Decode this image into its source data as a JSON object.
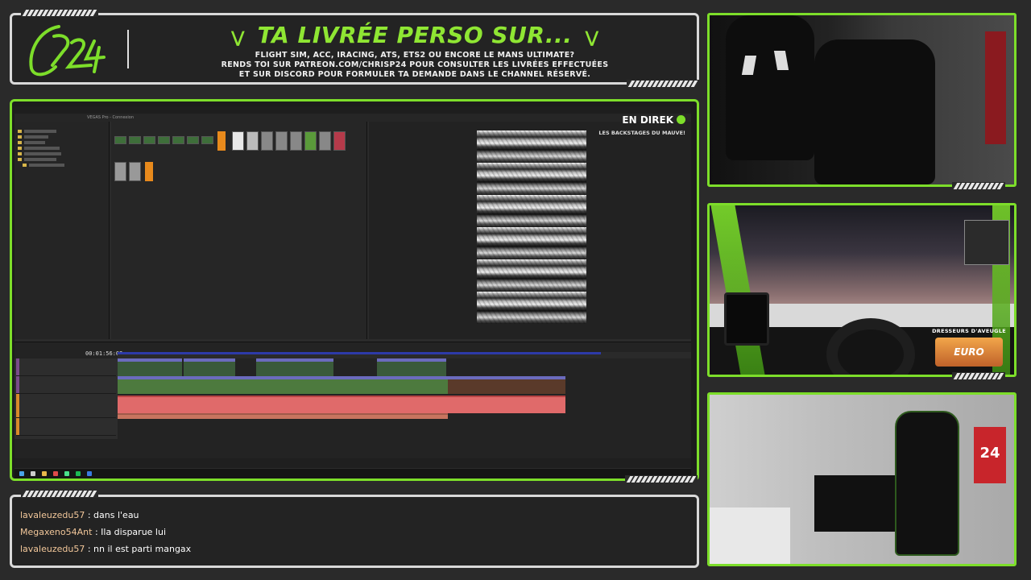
{
  "banner": {
    "title": "TA LIVRÉE PERSO SUR...",
    "line1": "FLIGHT SIM, ACC, IRACING, ATS, ETS2 OU ENCORE LE MANS ULTIMATE?",
    "line2": "RENDS TOI SUR PATREON.COM/CHRISP24 POUR CONSULTER LES LIVRÉES EFFECTUÉES",
    "line3": "ET SUR DISCORD POUR FORMULER TA DEMANDE DANS LE CHANNEL RÉSERVÉ.",
    "logo_icon": "cp24-logo"
  },
  "live": {
    "title": "EN DIREK",
    "subtitle": "LES BACKSTAGES DU MAUVE!"
  },
  "vegas": {
    "window_title": "VEGAS Pro - Connexion",
    "timecode": "00:01:56:02"
  },
  "chat": {
    "messages": [
      {
        "user": "lavaleuzedu57",
        "text": ": dans l'eau"
      },
      {
        "user": "Megaxeno54Ant",
        "text": ": Ila disparue lui"
      },
      {
        "user": "lavaleuzedu57",
        "text": ": nn il est parti mangax"
      }
    ]
  },
  "cams": {
    "truck_overlay_title": "DRESSEURS D'AVEUGLE",
    "game_logo": "EURO TRUCK",
    "jersey": "24"
  },
  "colors": {
    "accent": "#7dde2a",
    "frame": "#d9d9d9",
    "chat_user": "#f2c79a"
  }
}
